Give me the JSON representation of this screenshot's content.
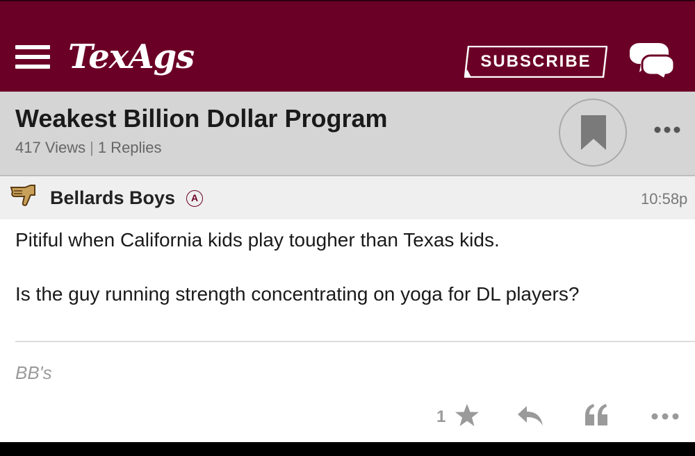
{
  "header": {
    "logo": "TexAgs",
    "subscribe_label": "SUBSCRIBE",
    "brand_color": "#6b0026",
    "icons": {
      "menu": "hamburger-menu-icon",
      "chat": "chat-bubbles-icon"
    }
  },
  "topic": {
    "title": "Weakest Billion Dollar Program",
    "views": "417 Views",
    "separator": "|",
    "replies": "1 Replies",
    "icons": {
      "bookmark": "bookmark-icon",
      "more": "more-dots-icon"
    }
  },
  "post": {
    "author": "Bellards Boys",
    "badge": "A",
    "time": "10:58p",
    "lines": [
      "Pitiful when California kids play tougher than Texas kids.",
      "Is the guy running strength concentrating on yoga for DL players?"
    ],
    "signature": "BB's",
    "actions": {
      "like_count": "1",
      "icons": [
        "star-icon",
        "reply-icon",
        "quote-icon",
        "more-dots-icon"
      ]
    }
  }
}
